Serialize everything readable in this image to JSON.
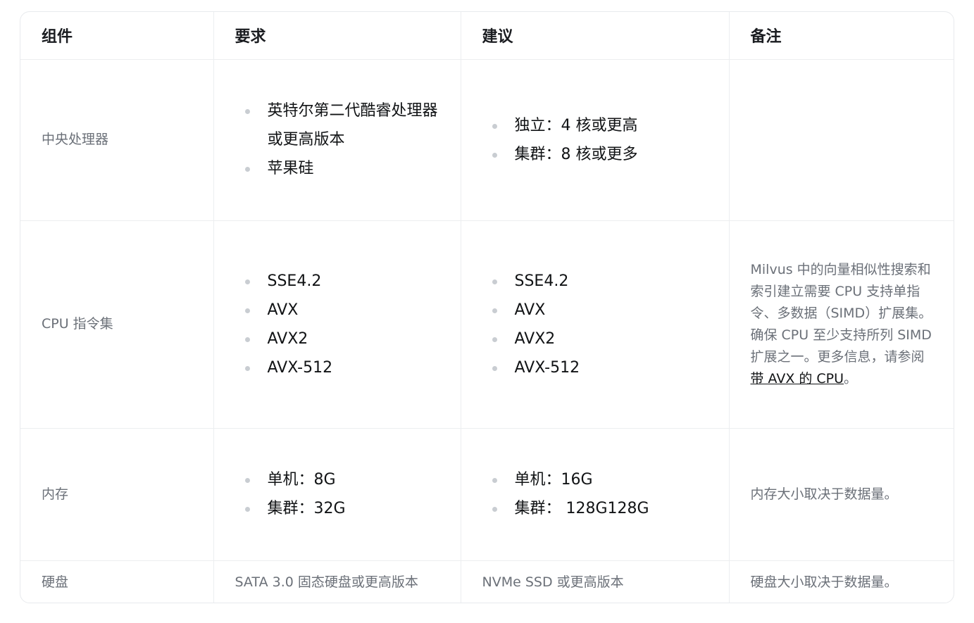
{
  "headers": [
    "组件",
    "要求",
    "建议",
    "备注"
  ],
  "rows": {
    "cpu": {
      "component": "中央处理器",
      "requirement": [
        "英特尔第二代酷睿处理器或更高版本",
        "苹果硅"
      ],
      "recommendation": [
        "独立：4 核或更高",
        "集群：8 核或更多"
      ],
      "note": ""
    },
    "isa": {
      "component": "CPU 指令集",
      "requirement": [
        "SSE4.2",
        "AVX",
        "AVX2",
        "AVX-512"
      ],
      "recommendation": [
        "SSE4.2",
        "AVX",
        "AVX2",
        "AVX-512"
      ],
      "note_prefix": "Milvus 中的向量相似性搜索和索引建立需要 CPU 支持单指令、多数据（SIMD）扩展集。确保 CPU 至少支持所列 SIMD 扩展之一。更多信息，请参阅",
      "note_link": "带 AVX 的 CPU",
      "note_suffix": "。"
    },
    "memory": {
      "component": "内存",
      "requirement": [
        "单机：8G",
        "集群：32G"
      ],
      "recommendation": [
        "单机：16G",
        "集群： 128G128G"
      ],
      "note": "内存大小取决于数据量。"
    },
    "disk": {
      "component": "硬盘",
      "requirement": "SATA 3.0 固态硬盘或更高版本",
      "recommendation": "NVMe SSD 或更高版本",
      "note": "硬盘大小取决于数据量。"
    }
  }
}
